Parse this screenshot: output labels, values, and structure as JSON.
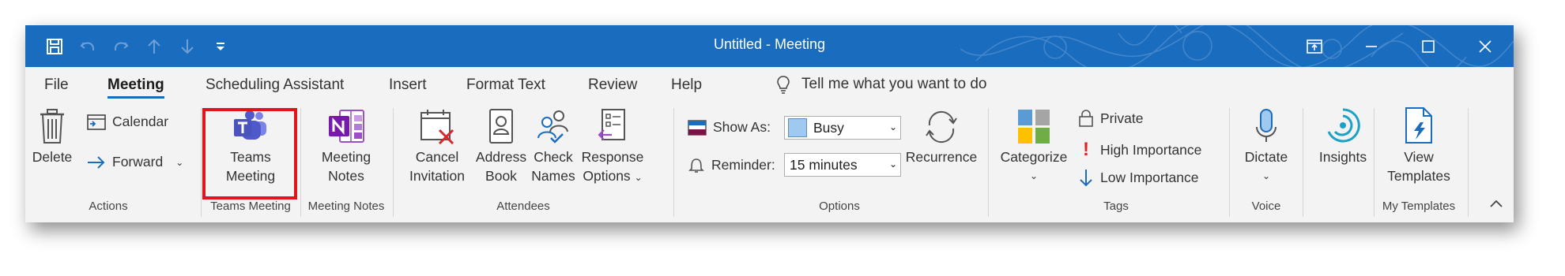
{
  "window": {
    "title": "Untitled  -  Meeting"
  },
  "qat": {
    "icons": [
      "save-icon",
      "undo-icon",
      "redo-icon",
      "up-arrow-icon",
      "down-arrow-icon",
      "customize-qat-icon"
    ]
  },
  "tabs": [
    "File",
    "Meeting",
    "Scheduling Assistant",
    "Insert",
    "Format Text",
    "Review",
    "Help"
  ],
  "active_tab": "Meeting",
  "tellme": {
    "text": "Tell me what you want to do"
  },
  "groups": {
    "actions": {
      "label": "Actions",
      "delete": "Delete",
      "calendar": "Calendar",
      "forward": "Forward"
    },
    "teams": {
      "label": "Teams Meeting",
      "button_line1": "Teams",
      "button_line2": "Meeting"
    },
    "notes": {
      "label": "Meeting Notes",
      "button_line1": "Meeting",
      "button_line2": "Notes"
    },
    "attendees": {
      "label": "Attendees",
      "cancel_line1": "Cancel",
      "cancel_line2": "Invitation",
      "address_line1": "Address",
      "address_line2": "Book",
      "check_line1": "Check",
      "check_line2": "Names",
      "response_line1": "Response",
      "response_line2": "Options"
    },
    "options": {
      "label": "Options",
      "show_as_label": "Show As:",
      "show_as_value": "Busy",
      "reminder_label": "Reminder:",
      "reminder_value": "15 minutes",
      "recurrence": "Recurrence"
    },
    "tags": {
      "label": "Tags",
      "categorize": "Categorize",
      "private": "Private",
      "high": "High Importance",
      "low": "Low Importance"
    },
    "voice": {
      "label": "Voice",
      "dictate": "Dictate"
    },
    "insights": {
      "button": "Insights"
    },
    "templates": {
      "label": "My Templates",
      "button_line1": "View",
      "button_line2": "Templates"
    }
  },
  "colors": {
    "titlebar": "#1a6cbf",
    "highlight": "#e0141b",
    "teams": "#5059c9",
    "onenote": "#7719aa",
    "busy": "#9fc9ef"
  }
}
